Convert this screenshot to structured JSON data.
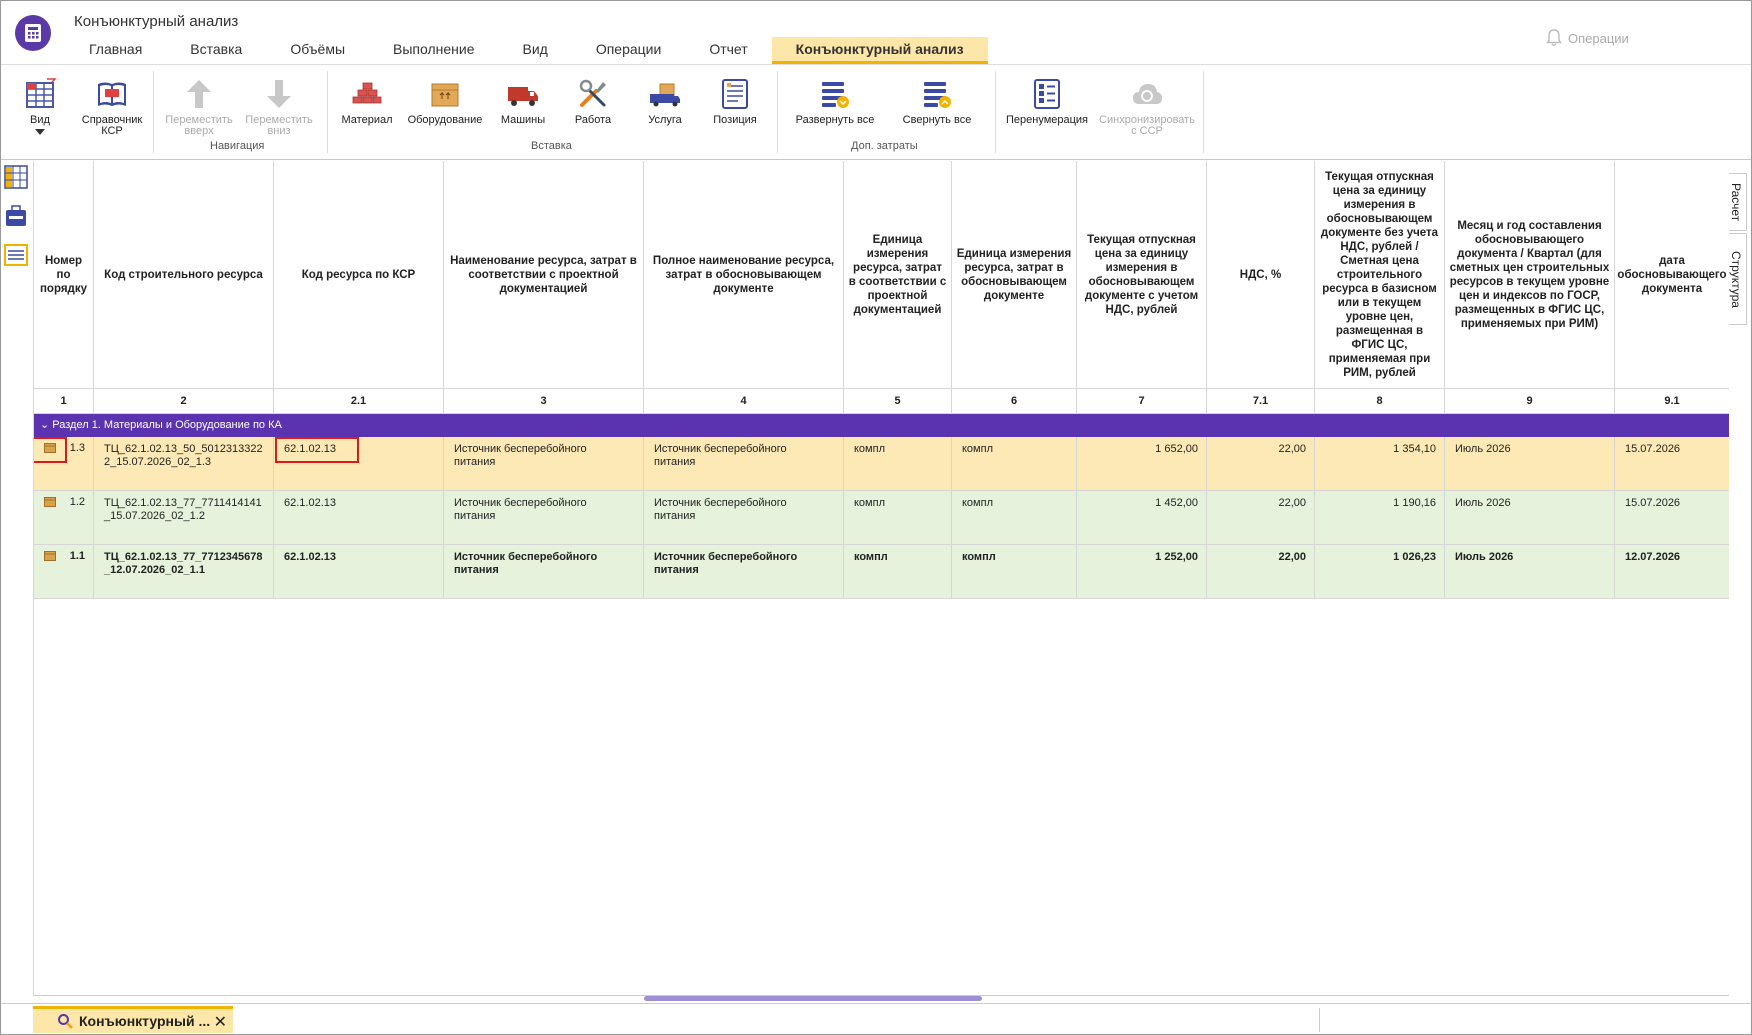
{
  "app": {
    "title": "Конъюнктурный анализ"
  },
  "tabs": [
    "Главная",
    "Вставка",
    "Объёмы",
    "Выполнение",
    "Вид",
    "Операции",
    "Отчет",
    "Конъюнктурный анализ"
  ],
  "operations_label": "Операции",
  "ribbon": {
    "view": "Вид",
    "ksr_line1": "Справочник",
    "ksr_line2": "КСР",
    "move_up_1": "Переместить",
    "move_up_2": "вверх",
    "move_down_1": "Переместить",
    "move_down_2": "вниз",
    "nav_group": "Навигация",
    "material": "Материал",
    "equipment": "Оборудование",
    "machines": "Машины",
    "work": "Работа",
    "service": "Услуга",
    "position": "Позиция",
    "insert_group": "Вставка",
    "expand_all": "Развернуть все",
    "collapse_all": "Свернуть все",
    "extra_group": "Доп. затраты",
    "renumber": "Перенумерация",
    "sync_1": "Синхронизировать",
    "sync_2": "с ССР"
  },
  "side_tabs": {
    "calc": "Расчет",
    "structure": "Структура"
  },
  "columns": [
    {
      "header": "Номер по порядку",
      "num": "1"
    },
    {
      "header": "Код строительного ресурса",
      "num": "2"
    },
    {
      "header": "Код ресурса по КСР",
      "num": "2.1"
    },
    {
      "header": "Наименование ресурса, затрат в соответствии с проектной документацией",
      "num": "3"
    },
    {
      "header": "Полное наименование ресурса, затрат в обосновывающем документе",
      "num": "4"
    },
    {
      "header": "Единица измерения ресурса, затрат в соответствии с проектной документацией",
      "num": "5"
    },
    {
      "header": "Единица измерения ресурса, затрат в обосновывающем документе",
      "num": "6"
    },
    {
      "header": "Текущая отпускная цена за единицу измерения в обосновывающем документе с учетом НДС, рублей",
      "num": "7"
    },
    {
      "header": "НДС, %",
      "num": "7.1"
    },
    {
      "header": "Текущая отпускная цена за единицу измерения в обосновывающем документе без учета НДС, рублей / Сметная цена строительного ресурса в базисном или в текущем уровне цен, размещенная в ФГИС ЦС, применяемая при РИМ, рублей",
      "num": "8"
    },
    {
      "header": "Месяц и год составления обосновывающего документа / Квартал (для сметных цен строительных ресурсов в текущем уровне цен и индексов по ГОСР, размещенных в ФГИС ЦС, применяемых при РИМ)",
      "num": "9"
    },
    {
      "header": "дата обосновывающего документа",
      "num": "9.1"
    }
  ],
  "section_title": "Раздел 1. Материалы и Оборудование по КА",
  "rows": [
    {
      "no": "1.3",
      "code": "ТЦ_62.1.02.13_50_5012313322\n2_15.07.2026_02_1.3",
      "ksr": "62.1.02.13",
      "name": "Источник бесперебойного\nпитания",
      "full": "Источник бесперебойного\nпитания",
      "unit_p": "компл",
      "unit_d": "компл",
      "price_vat": "1 652,00",
      "vat": "22,00",
      "price": "1 354,10",
      "month": "Июль 2026",
      "date": "15.07.2026"
    },
    {
      "no": "1.2",
      "code": "ТЦ_62.1.02.13_77_7711414141\n_15.07.2026_02_1.2",
      "ksr": "62.1.02.13",
      "name": "Источник бесперебойного\nпитания",
      "full": "Источник бесперебойного\nпитания",
      "unit_p": "компл",
      "unit_d": "компл",
      "price_vat": "1 452,00",
      "vat": "22,00",
      "price": "1 190,16",
      "month": "Июль 2026",
      "date": "15.07.2026"
    },
    {
      "no": "1.1",
      "code": "ТЦ_62.1.02.13_77_7712345678\n_12.07.2026_02_1.1",
      "ksr": "62.1.02.13",
      "name": "Источник бесперебойного\nпитания",
      "full": "Источник бесперебойного\nпитания",
      "unit_p": "компл",
      "unit_d": "компл",
      "price_vat": "1 252,00",
      "vat": "22,00",
      "price": "1 026,23",
      "month": "Июль 2026",
      "date": "12.07.2026"
    }
  ],
  "doc_tab": "Конъюнктурный ...",
  "colors": {
    "accent": "#5b32b0",
    "tab_active": "#fde7a8",
    "row_selected": "#fde9b5",
    "row_normal": "#e6f2dc"
  }
}
